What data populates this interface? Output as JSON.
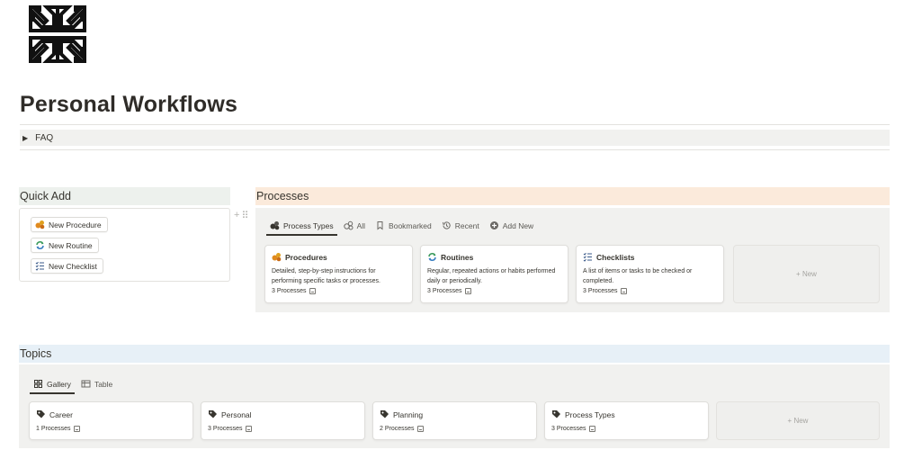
{
  "page": {
    "title": "Personal Workflows",
    "icon": "arrows-collapse-icon"
  },
  "faq": {
    "label": "FAQ",
    "icon": "triangle-right-icon"
  },
  "quick_add": {
    "heading": "Quick Add",
    "buttons": [
      {
        "label": "New Procedure",
        "icon": "procedure-icon"
      },
      {
        "label": "New Routine",
        "icon": "routine-icon"
      },
      {
        "label": "New Checklist",
        "icon": "checklist-icon"
      }
    ]
  },
  "handles": {
    "add": "+",
    "drag": "⠿"
  },
  "processes": {
    "heading": "Processes",
    "tabs": [
      {
        "label": "Process Types",
        "icon": "procedure-icon",
        "active": true
      },
      {
        "label": "All",
        "icon": "procedure-icon"
      },
      {
        "label": "Bookmarked",
        "icon": "bookmark-icon"
      },
      {
        "label": "Recent",
        "icon": "history-icon"
      },
      {
        "label": "Add New",
        "icon": "plus-circle-icon"
      }
    ],
    "cards": [
      {
        "title": "Procedures",
        "icon": "procedure-icon",
        "desc": "Detailed, step-by-step instructions for performing specific tasks or processes.",
        "count": "3 Processes"
      },
      {
        "title": "Routines",
        "icon": "routine-icon",
        "desc": "Regular, repeated actions or habits performed daily or periodically.",
        "count": "3 Processes"
      },
      {
        "title": "Checklists",
        "icon": "checklist-icon",
        "desc": "A list of items or tasks to be checked or completed.",
        "count": "3 Processes"
      }
    ],
    "new_label": "+ New"
  },
  "topics": {
    "heading": "Topics",
    "tabs": [
      {
        "label": "Gallery",
        "icon": "gallery-icon",
        "active": true
      },
      {
        "label": "Table",
        "icon": "table-icon"
      }
    ],
    "cards": [
      {
        "title": "Career",
        "count": "1 Processes",
        "icon": "tag-icon"
      },
      {
        "title": "Personal",
        "count": "3 Processes",
        "icon": "tag-icon"
      },
      {
        "title": "Planning",
        "count": "2 Processes",
        "icon": "tag-icon"
      },
      {
        "title": "Process Types",
        "count": "3 Processes",
        "icon": "tag-icon"
      }
    ],
    "new_label": "+ New"
  },
  "colors": {
    "quick_add_bg": "#edf1ed",
    "processes_bg": "#fbeadb",
    "topics_bg": "#e7f0f7",
    "panel_bg": "#f1f1ef",
    "procedure_orange": "#e08a1e",
    "routine_green": "#3a9a5b",
    "routine_blue": "#3a7fc1"
  }
}
